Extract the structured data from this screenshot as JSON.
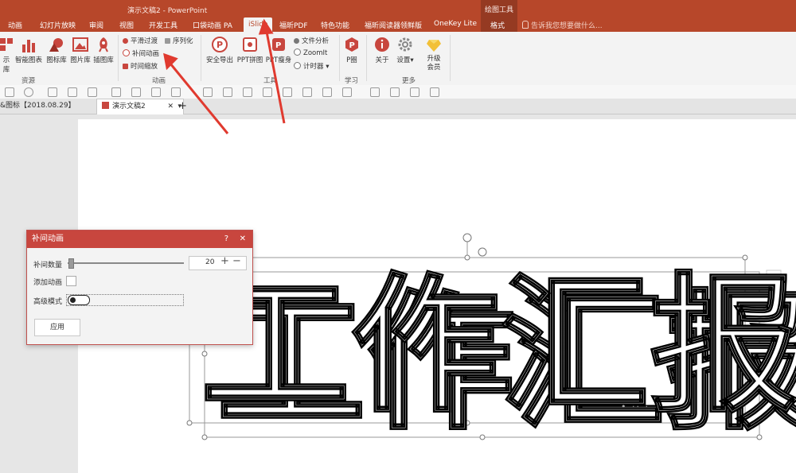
{
  "window": {
    "title": "演示文稿2 - PowerPoint",
    "context_tab_group": "绘图工具"
  },
  "tabs": [
    {
      "label": "动画"
    },
    {
      "label": "幻灯片放映"
    },
    {
      "label": "审阅"
    },
    {
      "label": "视图"
    },
    {
      "label": "开发工具"
    },
    {
      "label": "口袋动画 PA"
    },
    {
      "label": "iSlide"
    },
    {
      "label": "福昕PDF"
    },
    {
      "label": "特色功能"
    },
    {
      "label": "福昕阅读器领鲜版"
    },
    {
      "label": "OneKey Lite"
    },
    {
      "label": "格式"
    }
  ],
  "active_tab": "iSlide",
  "tell_me": "告诉我您想要做什么...",
  "ribbon": {
    "resources": {
      "label": "资源",
      "buttons": [
        "示库",
        "智能图表",
        "图标库",
        "图片库",
        "插图库"
      ]
    },
    "animation": {
      "label": "动画",
      "items": [
        "平滑过渡",
        "序列化",
        "补间动画",
        "时间缩放"
      ]
    },
    "tools": {
      "label": "工具",
      "buttons": [
        "安全导出",
        "PPT拼图",
        "PPT瘦身"
      ],
      "items": [
        "文件分析",
        "ZoomIt",
        "计时器"
      ]
    },
    "learn": {
      "label": "学习",
      "buttons": [
        "P圈"
      ]
    },
    "more": {
      "label": "更多",
      "buttons": [
        "关于",
        "设置",
        "升级会员"
      ]
    }
  },
  "doc_tabs": [
    {
      "label": "&图标【2018.08.29】"
    },
    {
      "label": "演示文稿2"
    }
  ],
  "dialog": {
    "title": "补间动画",
    "help": "?",
    "close": "✕",
    "count_label": "补间数量",
    "count_value": "20",
    "count_fraction": 0.0,
    "add_anim_label": "添加动画",
    "advanced_label": "高级模式",
    "apply_label": "应用"
  },
  "slide": {
    "text": "工作汇报"
  },
  "colors": {
    "accent": "#b7472a",
    "dialog_header": "#c8463e",
    "arrow": "#e03a2f"
  }
}
